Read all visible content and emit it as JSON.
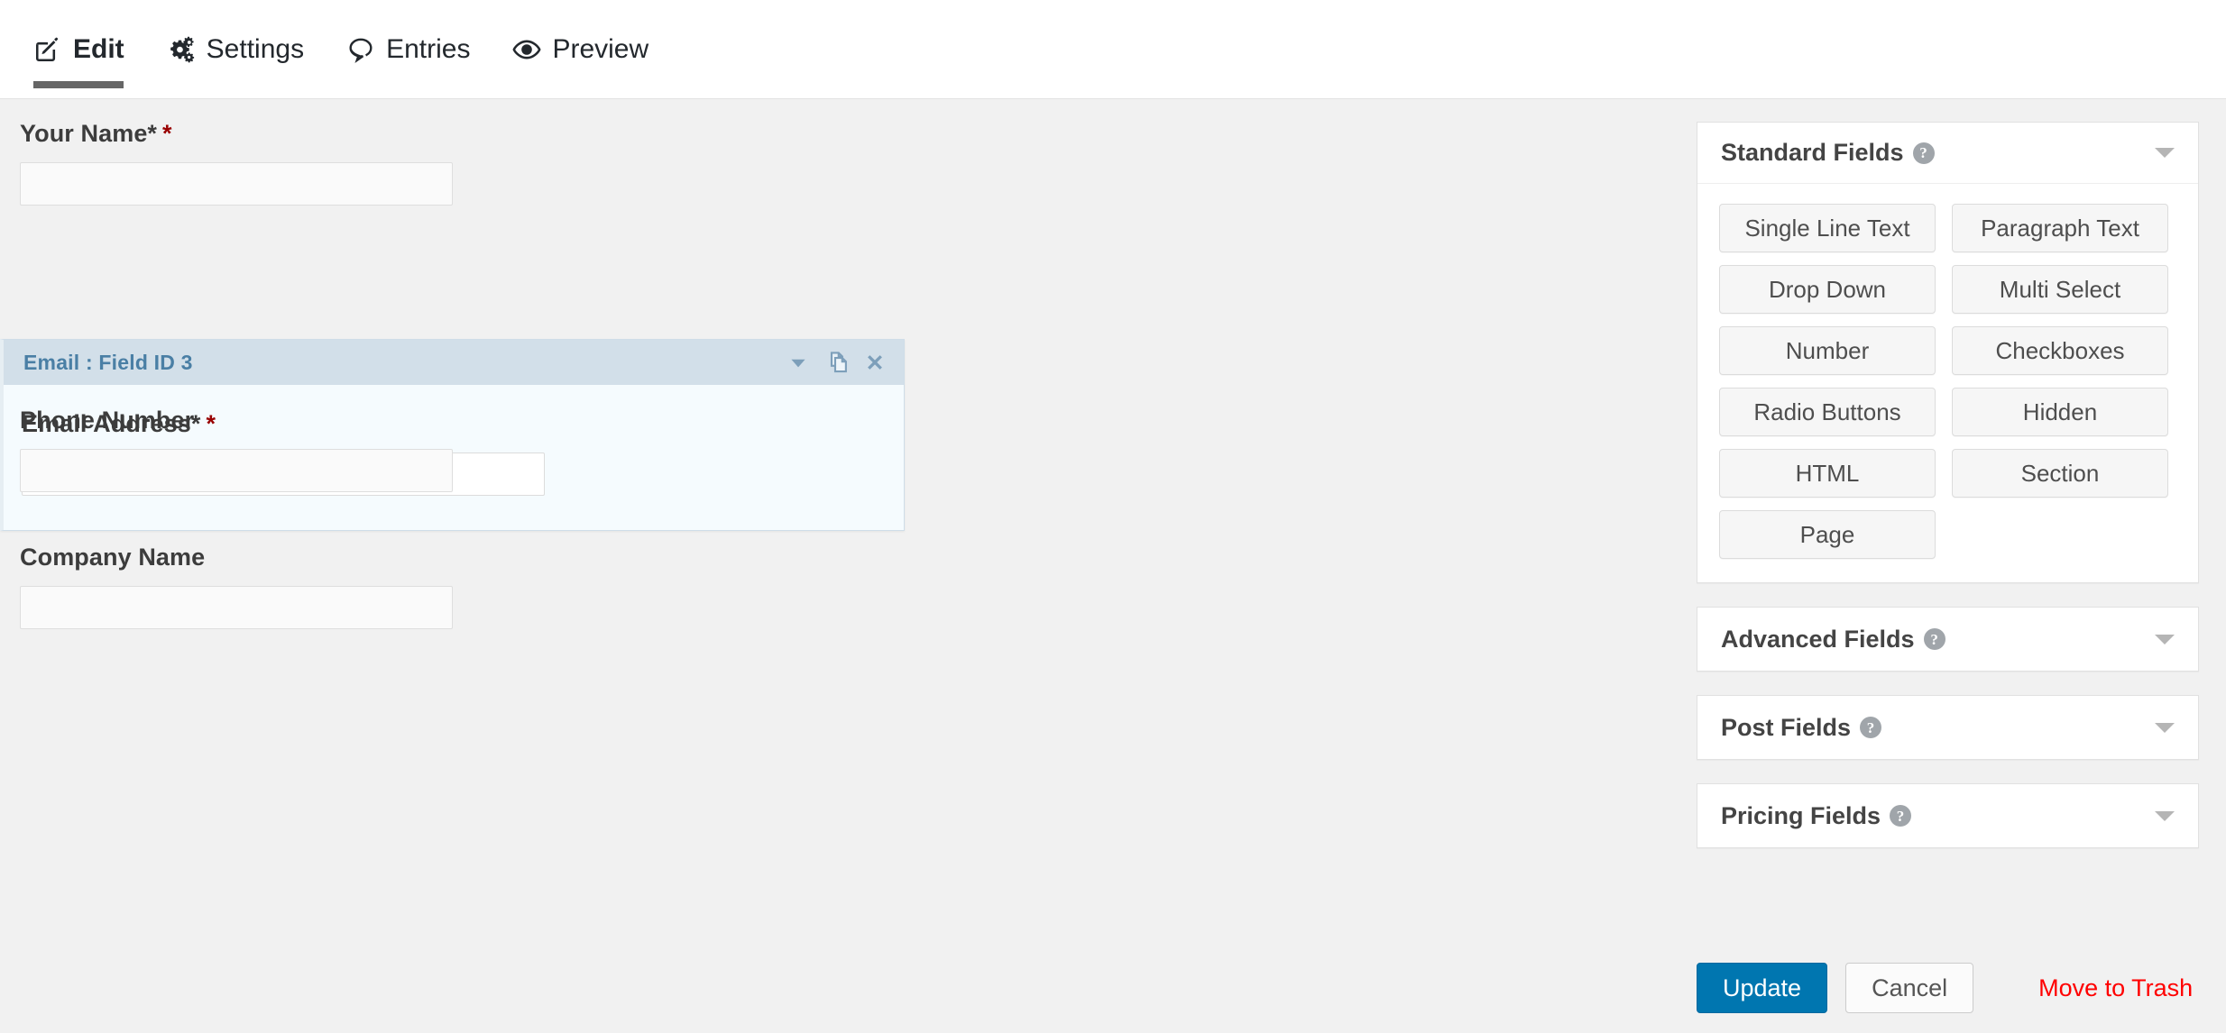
{
  "topbar": {
    "tabs": [
      {
        "label": "Edit",
        "icon": "edit-pencil-square-icon",
        "active": true
      },
      {
        "label": "Settings",
        "icon": "gears-icon",
        "active": false
      },
      {
        "label": "Entries",
        "icon": "speech-bubble-icon",
        "active": false
      },
      {
        "label": "Preview",
        "icon": "eye-icon",
        "active": false
      }
    ]
  },
  "editor": {
    "fields": [
      {
        "label": "Your Name*",
        "required_mark": "*",
        "value": "",
        "placeholder": ""
      },
      {
        "label": "Phone Number",
        "required_mark": "",
        "value": "",
        "placeholder": ""
      },
      {
        "label": "Company Name",
        "required_mark": "",
        "value": "",
        "placeholder": ""
      }
    ],
    "selected_field": {
      "header_title": "Email : Field ID 3",
      "label": "Email Address*",
      "required_mark": "*",
      "value": "",
      "placeholder": "",
      "actions": [
        {
          "name": "collapse-arrow-icon",
          "glyph": "caret-down"
        },
        {
          "name": "duplicate-field-icon",
          "glyph": "duplicate"
        },
        {
          "name": "delete-field-icon",
          "glyph": "close-x"
        }
      ]
    }
  },
  "sidebar": {
    "panels": [
      {
        "title": "Standard Fields",
        "help_icon": "help-question-icon",
        "toggle_icon": "chevron-down-icon",
        "expanded": true,
        "buttons": [
          "Single Line Text",
          "Paragraph Text",
          "Drop Down",
          "Multi Select",
          "Number",
          "Checkboxes",
          "Radio Buttons",
          "Hidden",
          "HTML",
          "Section",
          "Page"
        ]
      },
      {
        "title": "Advanced Fields",
        "help_icon": "help-question-icon",
        "toggle_icon": "chevron-down-icon",
        "expanded": false,
        "buttons": []
      },
      {
        "title": "Post Fields",
        "help_icon": "help-question-icon",
        "toggle_icon": "chevron-down-icon",
        "expanded": false,
        "buttons": []
      },
      {
        "title": "Pricing Fields",
        "help_icon": "help-question-icon",
        "toggle_icon": "chevron-down-icon",
        "expanded": false,
        "buttons": []
      }
    ],
    "help_glyph": "?"
  },
  "actions": {
    "update_label": "Update",
    "cancel_label": "Cancel",
    "trash_label": "Move to Trash"
  },
  "colors": {
    "accent_blue": "#0076b0",
    "selected_header_bg": "#d2dfe9",
    "selected_title_text": "#4a7fa5",
    "selected_body_bg": "#f5fbfe",
    "required_red": "#990000",
    "danger_red": "#ff0000",
    "page_bg": "#f1f1f1",
    "active_tab_underline": "#666666"
  }
}
